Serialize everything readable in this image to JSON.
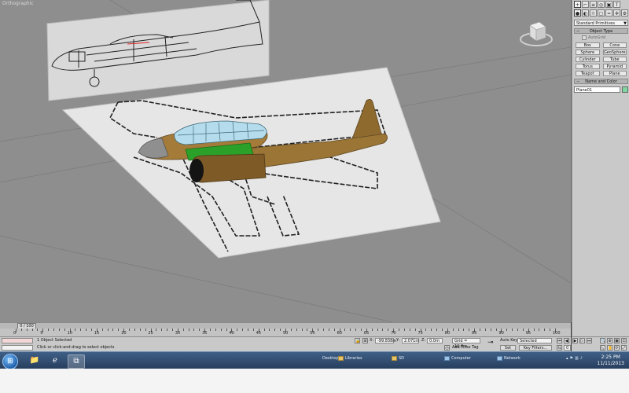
{
  "viewport": {
    "label": "Orthographic"
  },
  "command_panel": {
    "tabs": [
      "+",
      "⌐",
      "≡",
      "◎",
      "▣",
      "T"
    ],
    "subtabs": [
      "●",
      "◐",
      "☼",
      "▢",
      "≈",
      "✲",
      "⚙"
    ],
    "category": "Standard Primitives",
    "object_type_title": "Object Type",
    "autogrid_label": "AutoGrid",
    "primitives": [
      "Box",
      "Cone",
      "Sphere",
      "GeoSphere",
      "Cylinder",
      "Tube",
      "Torus",
      "Pyramid",
      "Teapot",
      "Plane"
    ],
    "name_color_title": "Name and Color",
    "object_name": "Plane01",
    "object_color": "#7fd6a0"
  },
  "timeline": {
    "frame_indicator": "0 / 100",
    "ticks": [
      "0",
      "5",
      "10",
      "15",
      "20",
      "25",
      "30",
      "35",
      "40",
      "45",
      "50",
      "55",
      "60",
      "65",
      "70",
      "75",
      "80",
      "85",
      "90",
      "95",
      "100"
    ]
  },
  "status": {
    "selection": "1 Object Selected",
    "prompt": "Click or click-and-drag to select objects",
    "x_label": "X:",
    "x_value": "-99.838m",
    "y_label": "Y:",
    "y_value": "2.071m",
    "z_label": "Z:",
    "z_value": "0.0m",
    "grid": "Grid = 10.0m",
    "add_time_tag": "Add Time Tag",
    "auto_key": "Auto Key",
    "selected_dropdown": "Selected",
    "set_key": "Set Key",
    "key_filters": "Key Filters...",
    "frame_field": "0"
  },
  "taskbar": {
    "desktop": "Desktop",
    "libraries": "Libraries",
    "sd": "SD",
    "computer": "Computer",
    "network": "Network",
    "time": "2:25 PM",
    "date": "11/11/2013"
  }
}
